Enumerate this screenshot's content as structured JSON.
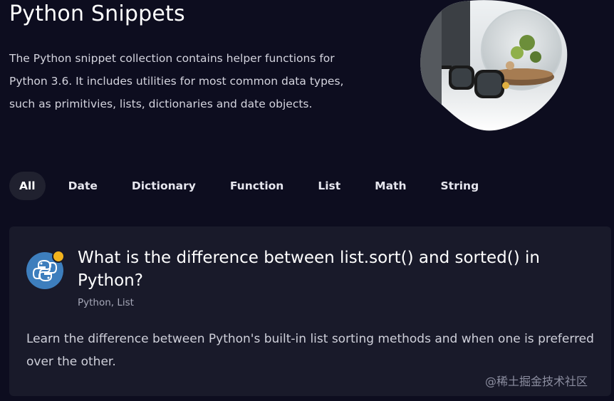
{
  "hero": {
    "title": "Python Snippets",
    "description": "The Python snippet collection contains helper functions for Python 3.6. It includes utilities for most common data types, such as primitivies, lists, dictionaries and date objects."
  },
  "tabs": [
    {
      "label": "All",
      "active": true
    },
    {
      "label": "Date",
      "active": false
    },
    {
      "label": "Dictionary",
      "active": false
    },
    {
      "label": "Function",
      "active": false
    },
    {
      "label": "List",
      "active": false
    },
    {
      "label": "Math",
      "active": false
    },
    {
      "label": "String",
      "active": false
    }
  ],
  "card": {
    "icon": "python-logo-icon",
    "title": "What is the difference between list.sort() and sorted() in Python?",
    "tags": "Python, List",
    "description": "Learn the difference between Python's built-in list sorting methods and when one is preferred over the other."
  },
  "watermark": "@稀土掘金技术社区",
  "colors": {
    "background": "#0d0d1f",
    "card": "#191a2a",
    "icon_bg": "#3d7ebd",
    "badge": "#f2b31d"
  }
}
